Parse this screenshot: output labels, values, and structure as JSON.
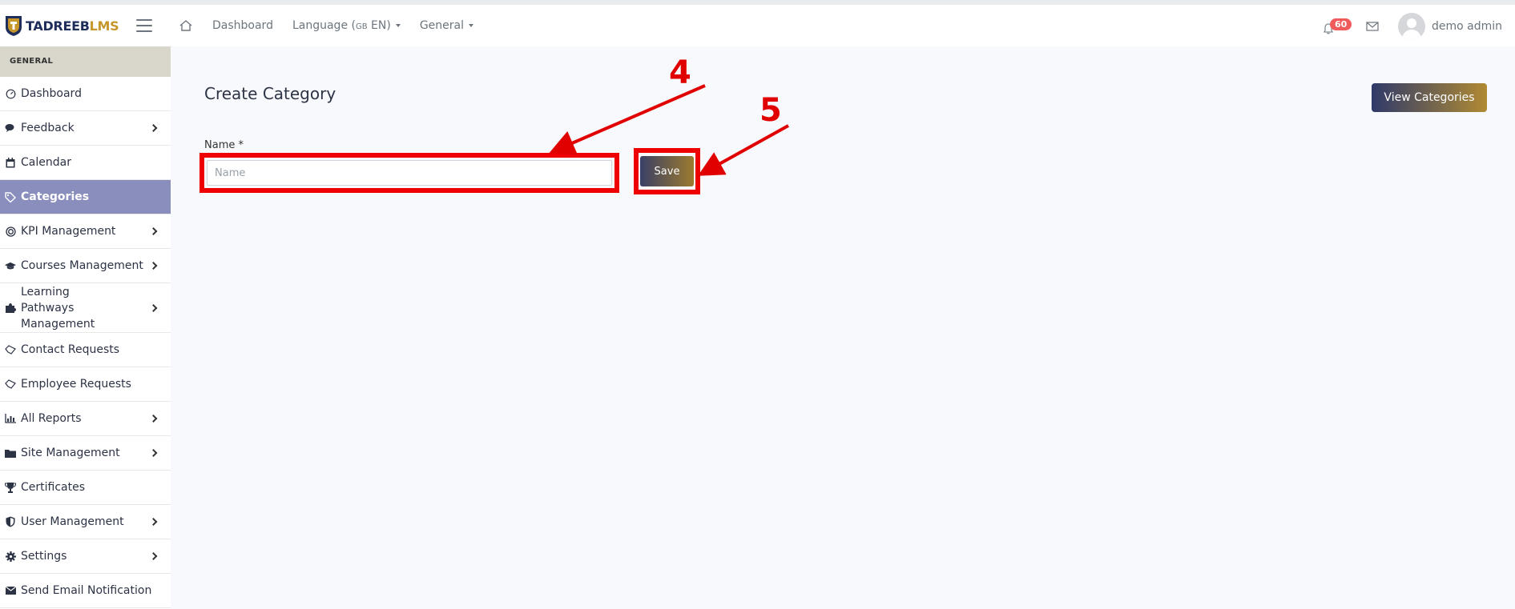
{
  "brand": {
    "part1": "TADREEB",
    "part2": "LMS",
    "colors": {
      "primary": "#1f2d5a",
      "accent": "#c7962b"
    }
  },
  "topbar": {
    "nav": [
      {
        "label": "Dashboard"
      },
      {
        "label": "Language (",
        "flag": "GB",
        "suffix": " EN)"
      },
      {
        "label": "General"
      }
    ],
    "notifications_count": "60",
    "username": "demo admin"
  },
  "sidebar": {
    "section_title": "GENERAL",
    "items": [
      {
        "label": "Dashboard",
        "icon": "gauge-icon",
        "chevron": false
      },
      {
        "label": "Feedback",
        "icon": "comments-icon",
        "chevron": true
      },
      {
        "label": "Calendar",
        "icon": "calendar-icon",
        "chevron": false
      },
      {
        "label": "Categories",
        "icon": "tags-icon",
        "chevron": false,
        "active": true
      },
      {
        "label": "KPI Management",
        "icon": "target-icon",
        "chevron": true
      },
      {
        "label": "Courses Management",
        "icon": "graduation-cap-icon",
        "chevron": true
      },
      {
        "label": "Learning Pathways Management",
        "icon": "puzzle-icon",
        "chevron": true
      },
      {
        "label": "Contact Requests",
        "icon": "handshake-icon",
        "chevron": false
      },
      {
        "label": "Employee Requests",
        "icon": "handshake-icon",
        "chevron": false
      },
      {
        "label": "All Reports",
        "icon": "chart-icon",
        "chevron": true
      },
      {
        "label": "Site Management",
        "icon": "folder-icon",
        "chevron": true
      },
      {
        "label": "Certificates",
        "icon": "trophy-icon",
        "chevron": false
      },
      {
        "label": "User Management",
        "icon": "shield-icon",
        "chevron": true
      },
      {
        "label": "Settings",
        "icon": "gear-icon",
        "chevron": true
      },
      {
        "label": "Send Email Notification",
        "icon": "envelope-icon",
        "chevron": false
      }
    ],
    "active_color": "#8a8ebd"
  },
  "main": {
    "title": "Create Category",
    "view_button": "View Categories",
    "form": {
      "name_label": "Name *",
      "name_placeholder": "Name",
      "name_value": "",
      "save_label": "Save"
    }
  },
  "annotations": {
    "step_a": "4",
    "step_b": "5",
    "color": "#e00000"
  }
}
